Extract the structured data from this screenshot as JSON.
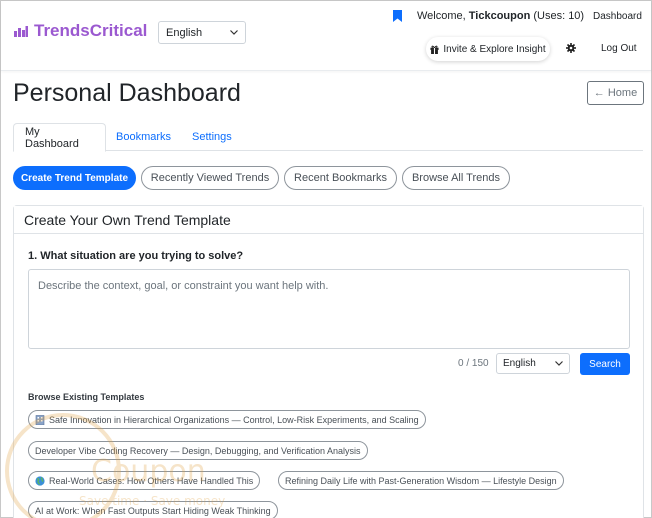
{
  "navbar": {
    "brand": "TrendsCritical",
    "language": "English",
    "welcome_prefix": "Welcome, ",
    "username": "Tickcoupon",
    "uses": " (Uses: 10)",
    "dashboard_link": "Dashboard",
    "invite_label": "Invite & Explore Insight",
    "logout_label": "Log Out"
  },
  "header": {
    "title": "Personal Dashboard",
    "home_button": "← Home"
  },
  "tabs": [
    "My Dashboard",
    "Bookmarks",
    "Settings"
  ],
  "pills": [
    "Create Trend Template",
    "Recently Viewed Trends",
    "Recent Bookmarks",
    "Browse All Trends"
  ],
  "card": {
    "title": "Create Your Own Trend Template",
    "question": "1. What situation are you trying to solve?",
    "placeholder": "Describe the context, goal, or constraint you want help with.",
    "char_count": "0 / 150",
    "language": "English",
    "search_label": "Search",
    "browse_label": "Browse Existing Templates",
    "templates": [
      {
        "label": "Safe Innovation in Hierarchical Organizations — Control, Low-Risk Experiments, and Scaling",
        "icon": "building-icon"
      },
      {
        "label": "Developer Vibe Coding Recovery — Design, Debugging, and Verification Analysis",
        "icon": ""
      },
      {
        "label": "Real-World Cases: How Others Have Handled This",
        "icon": "globe-icon"
      },
      {
        "label": "Refining Daily Life with Past-Generation Wisdom — Lifestyle Design",
        "icon": ""
      },
      {
        "label": "AI at Work: When Fast Outputs Start Hiding Weak Thinking",
        "icon": ""
      }
    ]
  },
  "watermark": {
    "brand": "Coupon",
    "tagline": "Save time · Save money"
  },
  "colors": {
    "brand": "#9b59d0",
    "primary": "#0d6efd"
  }
}
